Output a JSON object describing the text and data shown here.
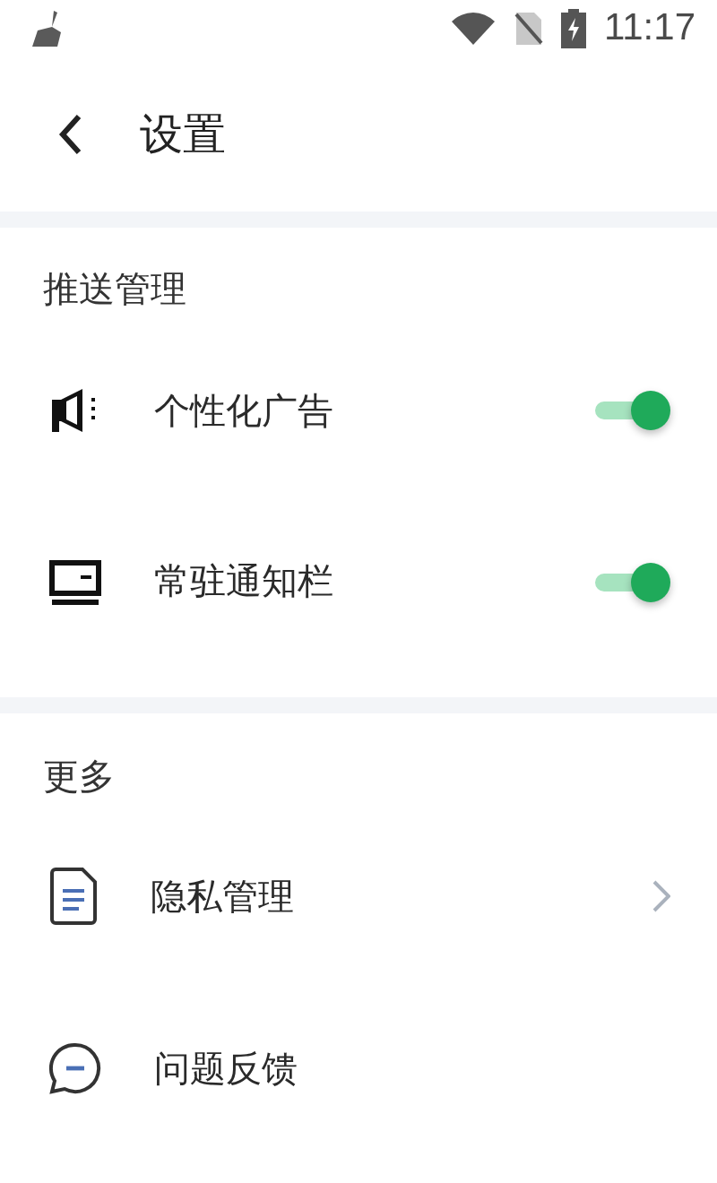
{
  "status_bar": {
    "time": "11:17"
  },
  "header": {
    "title": "设置"
  },
  "sections": [
    {
      "title": "推送管理",
      "items": [
        {
          "kind": "toggle",
          "label": "个性化广告",
          "on": true
        },
        {
          "kind": "toggle",
          "label": "常驻通知栏",
          "on": true
        }
      ]
    },
    {
      "title": "更多",
      "items": [
        {
          "kind": "link",
          "label": "隐私管理"
        },
        {
          "kind": "plain",
          "label": "问题反馈"
        }
      ]
    }
  ]
}
